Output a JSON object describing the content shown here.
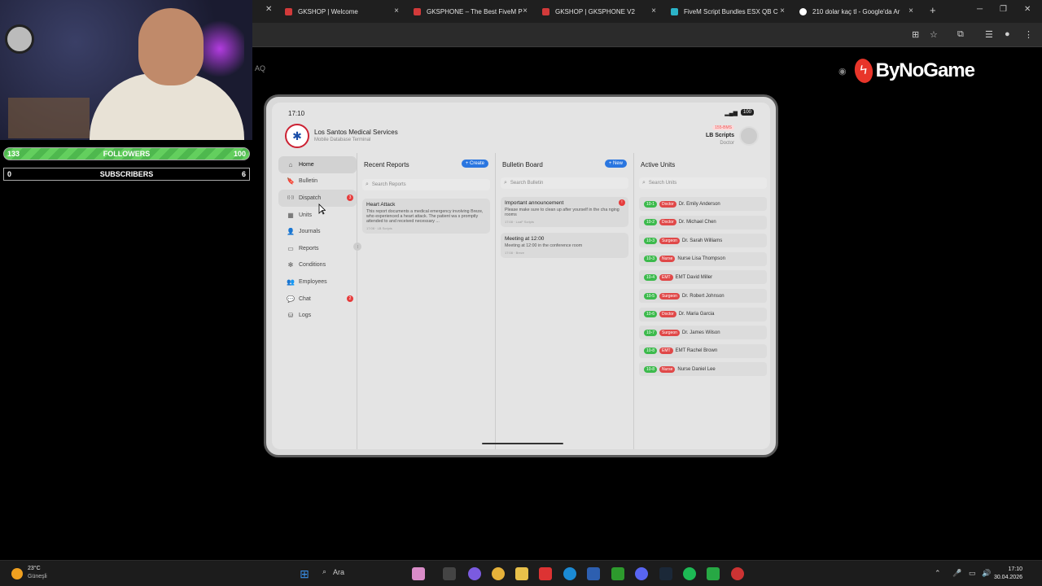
{
  "browser": {
    "tabs": [
      {
        "label": "GKSHOP | Welcome",
        "color": "#d23a3a"
      },
      {
        "label": "GKSPHONE – The Best FiveM P",
        "color": "#d23a3a"
      },
      {
        "label": "GKSHOP | GKSPHONE V2",
        "color": "#d23a3a"
      },
      {
        "label": "FiveM Script Bundles ESX QB C",
        "color": "#2bb3c7"
      },
      {
        "label": "210 dolar kaç tl - Google'da Ar",
        "color": "#ffffff"
      }
    ],
    "new_tab": "+",
    "close": "×"
  },
  "stream": {
    "followers_left": "133",
    "followers_label": "FOLLOWERS",
    "followers_right": "100",
    "subscribers_left": "0",
    "subscribers_label": "SUBSCRIBERS",
    "subscribers_right": "6",
    "aq": "AQ",
    "brand": "ByNoGame"
  },
  "tablet": {
    "time": "17:10",
    "battery": "100",
    "org_name": "Los Santos Medical Services",
    "org_subtitle": "Mobile Database Terminal",
    "user_id": "155-BMS",
    "user_name": "LB Scripts",
    "user_role": "Doctor",
    "nav": [
      {
        "label": "Home",
        "icon": "⌂",
        "icon_name": "home-icon"
      },
      {
        "label": "Bulletin",
        "icon": "🔖",
        "icon_name": "bookmark-icon"
      },
      {
        "label": "Dispatch",
        "icon": "((·))",
        "icon_name": "radio-icon",
        "badge": "3"
      },
      {
        "label": "Units",
        "icon": "▦",
        "icon_name": "grid-icon"
      },
      {
        "label": "Journals",
        "icon": "👤",
        "icon_name": "person-icon"
      },
      {
        "label": "Reports",
        "icon": "▭",
        "icon_name": "folder-icon"
      },
      {
        "label": "Conditions",
        "icon": "✻",
        "icon_name": "conditions-icon"
      },
      {
        "label": "Employees",
        "icon": "👥",
        "icon_name": "people-icon"
      },
      {
        "label": "Chat",
        "icon": "💬",
        "icon_name": "chat-icon",
        "badge": "2"
      },
      {
        "label": "Logs",
        "icon": "⛁",
        "icon_name": "database-icon"
      }
    ],
    "reports": {
      "title": "Recent Reports",
      "button": "+ Create",
      "search_placeholder": "Search Reports",
      "items": [
        {
          "title": "Heart Attack",
          "body": "This report documents a medical emergency involving Breze, who experienced a heart attack. The patient wa s promptly attended to and received necessary ...",
          "meta": "17:08 · LB Scripts"
        }
      ]
    },
    "bulletin": {
      "title": "Bulletin Board",
      "button": "+ New",
      "search_placeholder": "Search Bulletin",
      "items": [
        {
          "title": "Important announcement",
          "body": "Please make sure to clean up after yourself in the cha nging rooms",
          "meta": "17:08 · LoaF Scripts",
          "badge": "!"
        },
        {
          "title": "Meeting at 12:00",
          "body": "Meeting at 12:00 in the conference room",
          "meta": "17:08 · Breze",
          "badge": ""
        }
      ]
    },
    "units": {
      "title": "Active Units",
      "search_placeholder": "Search Units",
      "items": [
        {
          "code": "10-1",
          "role": "Doctor",
          "name": "Dr. Emily Anderson"
        },
        {
          "code": "10-2",
          "role": "Doctor",
          "name": "Dr. Michael Chen"
        },
        {
          "code": "10-3",
          "role": "Surgeon",
          "name": "Dr. Sarah Williams"
        },
        {
          "code": "10-3",
          "role": "Nurse",
          "name": "Nurse Lisa Thompson"
        },
        {
          "code": "10-4",
          "role": "EMT",
          "name": "EMT David Miller"
        },
        {
          "code": "10-5",
          "role": "Surgeon",
          "name": "Dr. Robert Johnson"
        },
        {
          "code": "10-6",
          "role": "Doctor",
          "name": "Dr. Maria Garcia"
        },
        {
          "code": "10-7",
          "role": "Surgeon",
          "name": "Dr. James Wilson"
        },
        {
          "code": "10-8",
          "role": "EMT",
          "name": "EMT Rachel Brown"
        },
        {
          "code": "10-8",
          "role": "Nurse",
          "name": "Nurse Daniel Lee"
        }
      ]
    }
  },
  "taskbar": {
    "temp": "23°C",
    "weather": "Güneşli",
    "search": "Ara",
    "time": "17:10",
    "date": "30.04.2026"
  }
}
